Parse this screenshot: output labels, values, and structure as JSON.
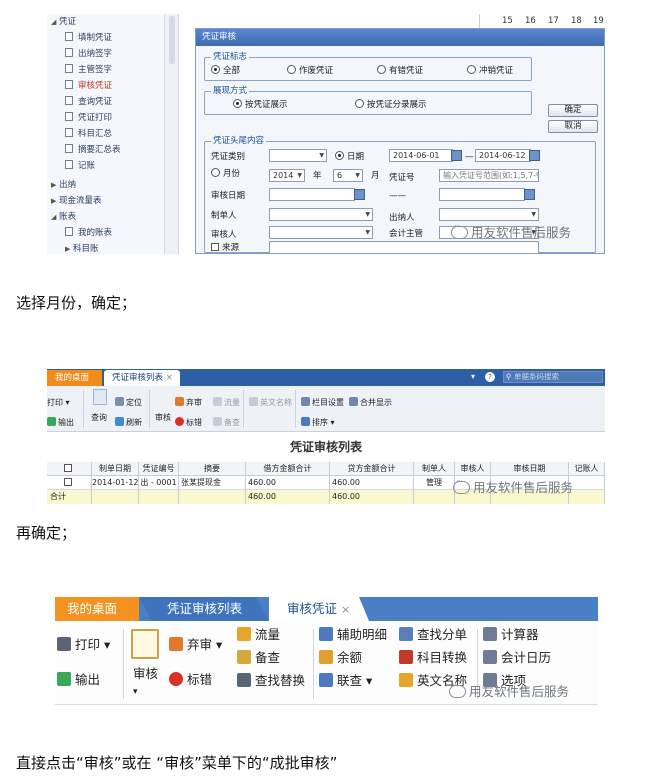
{
  "shot1": {
    "tree": [
      {
        "label": "凭证",
        "kind": "branch"
      },
      {
        "label": "填制凭证",
        "kind": "leaf"
      },
      {
        "label": "出纳签字",
        "kind": "leaf"
      },
      {
        "label": "主管签字",
        "kind": "leaf"
      },
      {
        "label": "审核凭证",
        "kind": "leaf",
        "active": true
      },
      {
        "label": "查询凭证",
        "kind": "leaf"
      },
      {
        "label": "凭证打印",
        "kind": "leaf"
      },
      {
        "label": "科目汇总",
        "kind": "leaf"
      },
      {
        "label": "摘要汇总表",
        "kind": "leaf"
      },
      {
        "label": "记账",
        "kind": "leaf"
      },
      {
        "label": "出纳",
        "kind": "branch"
      },
      {
        "label": "现金流量表",
        "kind": "branch"
      },
      {
        "label": "账表",
        "kind": "branch"
      },
      {
        "label": "我的账表",
        "kind": "leaf"
      },
      {
        "label": "科目账",
        "kind": "branch"
      }
    ],
    "calendar_days": [
      "15",
      "16",
      "17",
      "18",
      "19"
    ],
    "dialog": {
      "title": "凭证审核",
      "group_status": {
        "legend": "凭证标志",
        "options": [
          "全部",
          "作废凭证",
          "有错凭证",
          "冲销凭证"
        ],
        "selected": "全部"
      },
      "group_display": {
        "legend": "展现方式",
        "options": [
          "按凭证展示",
          "按凭证分录展示"
        ],
        "selected": "按凭证展示"
      },
      "ok_label": "确定",
      "cancel_label": "取消",
      "group_header": {
        "legend": "凭证头尾内容",
        "voucher_type_label": "凭证类别",
        "date_label": "日期",
        "date_from": "2014-06-01",
        "date_sep": "—",
        "date_to": "2014-06-12",
        "month_label": "月份",
        "year_value": "2014",
        "year_unit": "年",
        "month_value": "6",
        "month_unit": "月",
        "voucher_no_label": "凭证号",
        "voucher_no_placeholder": "输入凭证号范围(如:1,5,7-9",
        "dash": "——",
        "audit_date_label": "审核日期",
        "maker_label": "制单人",
        "cashier_label": "出纳人",
        "auditor_label": "审核人",
        "supervisor_label": "会计主管",
        "source_label": "来源"
      }
    },
    "watermark": "用友软件售后服务"
  },
  "text1": "选择月份，确定；",
  "shot2": {
    "tabs": [
      {
        "label": "我的桌面"
      },
      {
        "label": "凭证审核列表"
      }
    ],
    "tab_close": "×",
    "search_placeholder": "单据条码搜索",
    "toolbar": [
      {
        "label": "打印"
      },
      {
        "label": "输出"
      },
      {
        "label": "查询"
      },
      {
        "label": "定位"
      },
      {
        "label": "刷新"
      },
      {
        "label": "审核"
      },
      {
        "label": "弃审"
      },
      {
        "label": "流量"
      },
      {
        "label": "标错"
      },
      {
        "label": "备查"
      },
      {
        "label": "英文名称"
      },
      {
        "label": "栏目设置"
      },
      {
        "label": "排序"
      },
      {
        "label": "合并显示"
      }
    ],
    "title": "凭证审核列表",
    "columns": [
      "",
      "制单日期",
      "凭证编号",
      "摘要",
      "借方金额合计",
      "贷方金额合计",
      "制单人",
      "审核人",
      "审核日期",
      "记账人"
    ],
    "rows": [
      [
        "",
        "2014-01-12",
        "出 - 0001",
        "张某提现金",
        "460.00",
        "460.00",
        "管理",
        "",
        "",
        ""
      ],
      [
        "合计",
        "",
        "",
        "",
        "460.00",
        "460.00",
        "",
        "",
        "",
        ""
      ]
    ],
    "watermark": "用友软件售后服务"
  },
  "text2": "再确定；",
  "shot3": {
    "tabs": [
      {
        "label": "我的桌面"
      },
      {
        "label": "凭证审核列表"
      },
      {
        "label": "审核凭证"
      }
    ],
    "tab_close": "×",
    "toolbar": [
      {
        "label": "打印"
      },
      {
        "label": "输出"
      },
      {
        "label": "审核"
      },
      {
        "label": "弃审"
      },
      {
        "label": "标错"
      },
      {
        "label": "流量"
      },
      {
        "label": "备查"
      },
      {
        "label": "查找替换"
      },
      {
        "label": "辅助明细"
      },
      {
        "label": "余额"
      },
      {
        "label": "联查"
      },
      {
        "label": "查找分单"
      },
      {
        "label": "科目转换"
      },
      {
        "label": "英文名称"
      },
      {
        "label": "计算器"
      },
      {
        "label": "会计日历"
      },
      {
        "label": "选项"
      }
    ],
    "watermark": "用友软件售后服务"
  },
  "text3": "直接点击“审核”或在 “审核”菜单下的“成批审核”"
}
